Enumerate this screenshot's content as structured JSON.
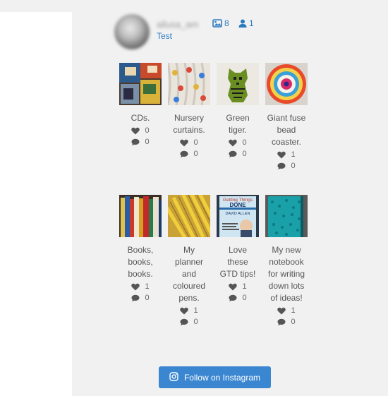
{
  "profile": {
    "username": "allusa_am",
    "bio": "Test",
    "photos_count": "8",
    "followers_count": "1"
  },
  "posts": [
    {
      "thumb": "cds",
      "caption": "CDs.",
      "likes": "0",
      "comments": "0"
    },
    {
      "thumb": "curtains",
      "caption": "Nursery curtains.",
      "likes": "0",
      "comments": "0"
    },
    {
      "thumb": "tiger",
      "caption": "Green tiger.",
      "likes": "0",
      "comments": "0"
    },
    {
      "thumb": "coaster",
      "caption": "Giant fuse bead coaster.",
      "likes": "1",
      "comments": "0"
    },
    {
      "thumb": "books",
      "caption": "Books, books, books.",
      "likes": "1",
      "comments": "0"
    },
    {
      "thumb": "pens",
      "caption": "My planner and coloured pens.",
      "likes": "1",
      "comments": "0"
    },
    {
      "thumb": "gtd",
      "caption": "Love these GTD tips!",
      "likes": "1",
      "comments": "0",
      "book_title_1": "Getting Things",
      "book_title_2": "DONE",
      "book_author": "DAVID ALLEN"
    },
    {
      "thumb": "notebook",
      "caption": "My new notebook for writing down lots of ideas!",
      "likes": "1",
      "comments": "0"
    }
  ],
  "follow_button": {
    "label": "Follow on Instagram",
    "color": "#3a86d0"
  },
  "colors": {
    "accent": "#2b7bbf",
    "background": "#f1f1f1",
    "panel": "#ffffff"
  }
}
